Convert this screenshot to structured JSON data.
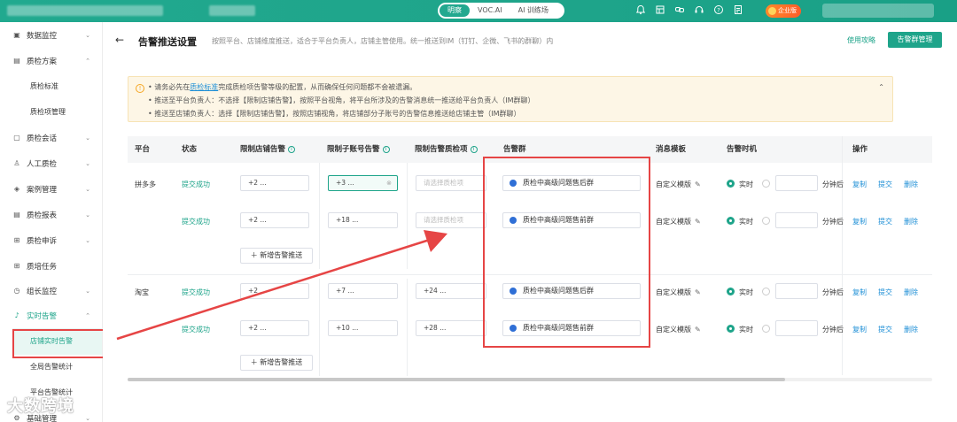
{
  "topbar": {
    "tabs": [
      {
        "label": "明察",
        "active": true
      },
      {
        "label": "VOC.AI",
        "active": false
      },
      {
        "label": "AI 训练场",
        "active": false
      }
    ],
    "icons": [
      "bell-icon",
      "grid-icon",
      "link-icon",
      "headset-icon",
      "help-icon",
      "doc-icon"
    ],
    "enterprise_badge": "企业版"
  },
  "sidebar": {
    "items": [
      {
        "label": "数据监控",
        "icon": "monitor-icon",
        "expanded": false
      },
      {
        "label": "质检方案",
        "icon": "doc-icon",
        "expanded": true
      },
      {
        "label": "质检标准",
        "sub": true
      },
      {
        "label": "质检项管理",
        "sub": true
      },
      {
        "label": "质检会话",
        "icon": "chat-icon",
        "expanded": false
      },
      {
        "label": "人工质检",
        "icon": "person-icon",
        "expanded": false
      },
      {
        "label": "案例管理",
        "icon": "layers-icon",
        "expanded": false
      },
      {
        "label": "质检报表",
        "icon": "report-icon",
        "expanded": false
      },
      {
        "label": "质检申诉",
        "icon": "appeal-icon",
        "expanded": false
      },
      {
        "label": "质培任务",
        "icon": "task-icon"
      },
      {
        "label": "组长监控",
        "icon": "clock-icon",
        "expanded": false
      },
      {
        "label": "实时告警",
        "icon": "bell-icon",
        "expanded": true
      },
      {
        "label": "店铺实时告警",
        "sub": true,
        "active": true
      },
      {
        "label": "全局告警统计",
        "sub": true
      },
      {
        "label": "平台告警统计",
        "sub": true
      },
      {
        "label": "基础管理",
        "icon": "settings-icon",
        "expanded": false
      }
    ],
    "watermark": "大数跨境"
  },
  "header": {
    "title": "告警推送设置",
    "description": "按照平台、店铺维度推送，适合于平台负责人，店铺主管使用。统一推送到IM（钉钉、企微、飞书的群聊）内",
    "guide_link": "使用攻略",
    "manage_button": "告警群管理"
  },
  "notice": {
    "line1_pre": "请务必先在",
    "line1_link": "质检标准",
    "line1_post": "完成质检项告警等级的配置，从而确保任何问题都不会被遗漏。",
    "line2": "推送至平台负责人：不选择【限制店铺告警】，按照平台视角，将平台所涉及的告警消息统一推送给平台负责人（IM群聊）",
    "line3": "推送至店铺负责人：选择【限制店铺告警】，按照店铺视角，将店铺部分子账号的告警信息推送给店铺主管（IM群聊）"
  },
  "table": {
    "columns": [
      "平台",
      "状态",
      "限制店铺告警",
      "限制子账号告警",
      "限制告警质检项",
      "告警群",
      "消息模板",
      "告警时机",
      "操作"
    ],
    "columns_with_help": [
      2,
      3,
      4
    ],
    "placeholder_item": "请选择质检项",
    "template_label": "自定义模版",
    "timing_realtime": "实时",
    "timing_unit": "分钟后",
    "actions": [
      "复制",
      "提交",
      "删除"
    ],
    "add_button": "新增告警推送",
    "rows": [
      {
        "platform": "拼多多",
        "status": "提交成功",
        "shop": "+2 ...",
        "subaccount": "+3 ...",
        "item": "",
        "group": "质检中高级问题售后群"
      },
      {
        "platform": "",
        "status": "提交成功",
        "shop": "+2 ...",
        "subaccount": "+18 ...",
        "item": "",
        "group": "质检中高级问题售前群"
      },
      {
        "platform": "淘宝",
        "status": "提交成功",
        "shop": "+2 ...",
        "subaccount": "+7 ...",
        "item": "+24 ...",
        "group": "质检中高级问题售后群"
      },
      {
        "platform": "",
        "status": "提交成功",
        "shop": "+2 ...",
        "subaccount": "+10 ...",
        "item": "+28 ...",
        "group": "质检中高级问题售前群"
      }
    ]
  },
  "colors": {
    "brand": "#1ea48a",
    "link": "#1e8fd6",
    "annotation": "#e64545",
    "notice_bg": "#fdf6e6"
  }
}
